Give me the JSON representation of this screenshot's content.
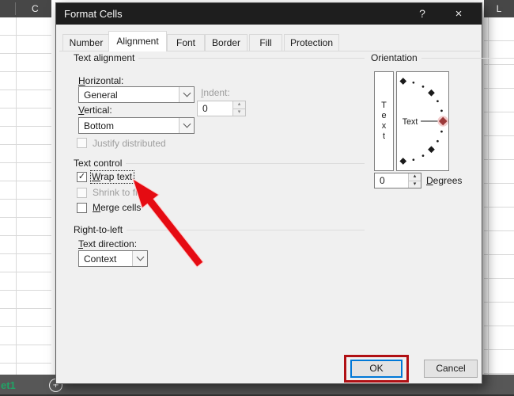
{
  "icons": {
    "help": "?",
    "close": "×",
    "check": "✓",
    "spinner_up": "▴",
    "spinner_down": "▾",
    "new_sheet": "+"
  },
  "background": {
    "left_column_header": "C",
    "right_column_header": "L",
    "sheet_tab_label": "et1"
  },
  "dialog": {
    "title": "Format Cells",
    "tabs": [
      {
        "label": "Number",
        "active": false
      },
      {
        "label": "Alignment",
        "active": true
      },
      {
        "label": "Font",
        "active": false
      },
      {
        "label": "Border",
        "active": false
      },
      {
        "label": "Fill",
        "active": false
      },
      {
        "label": "Protection",
        "active": false
      }
    ],
    "text_alignment": {
      "section_label": "Text alignment",
      "horizontal_label": {
        "u": "H",
        "rest": "orizontal:"
      },
      "horizontal_value": "General",
      "indent_label": {
        "u": "I",
        "rest": "ndent:"
      },
      "indent_value": "0",
      "vertical_label": {
        "u": "V",
        "rest": "ertical:"
      },
      "vertical_value": "Bottom",
      "justify_distributed_label": "Justify distributed",
      "justify_distributed_checked": false
    },
    "text_control": {
      "section_label": "Text control",
      "wrap_text_label": {
        "u": "W",
        "rest": "rap text"
      },
      "wrap_text_checked": true,
      "shrink_to_fit_label": "Shrink to fit",
      "shrink_to_fit_checked": false,
      "merge_cells_label": {
        "u": "M",
        "rest": "erge cells"
      },
      "merge_cells_checked": false
    },
    "right_to_left": {
      "section_label": "Right-to-left",
      "text_direction_label": {
        "u": "T",
        "rest": "ext direction:"
      },
      "text_direction_value": "Context"
    },
    "orientation": {
      "section_label": "Orientation",
      "vertical_text": [
        "T",
        "e",
        "x",
        "t"
      ],
      "dial_label": "Text",
      "degrees_value": "0",
      "degrees_label": {
        "u": "D",
        "rest": "egrees"
      }
    },
    "buttons": {
      "ok": "OK",
      "cancel": "Cancel"
    }
  },
  "colors": {
    "titlebar": "#1e1e1e",
    "dialog_bg": "#f0f0f0",
    "accent_blue": "#0078d7",
    "annotation_red": "#b01014",
    "arrow_red": "#e50b12",
    "excel_green": "#21a366",
    "column_header_bg": "#474747",
    "sheet_bar_bg": "#575757"
  }
}
